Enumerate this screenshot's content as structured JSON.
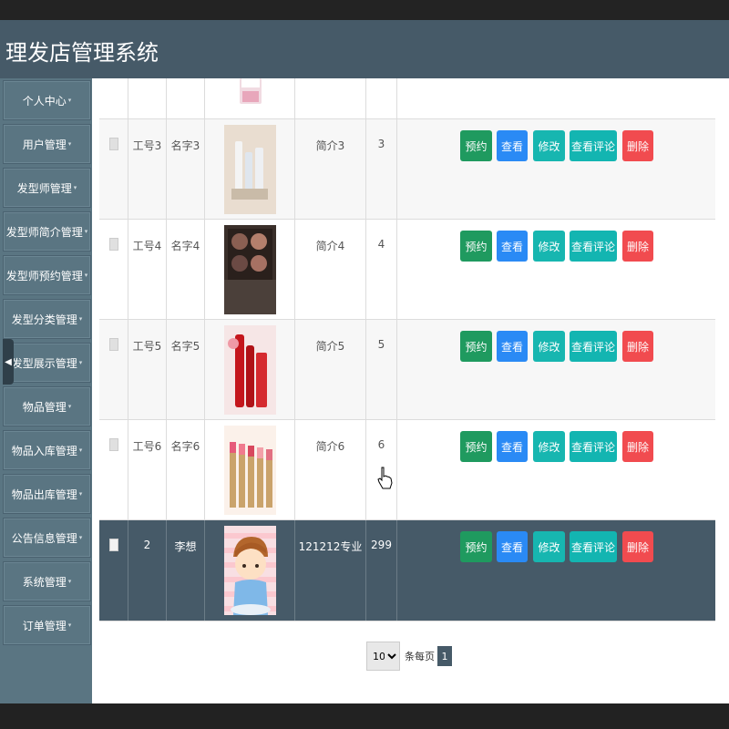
{
  "app": {
    "title": "理发店管理系统"
  },
  "sidebar": {
    "items": [
      {
        "label": "个人中心"
      },
      {
        "label": "用户管理"
      },
      {
        "label": "发型师管理"
      },
      {
        "label": "发型师简介管理"
      },
      {
        "label": "发型师预约管理"
      },
      {
        "label": "发型分类管理"
      },
      {
        "label": "发型展示管理"
      },
      {
        "label": "物品管理"
      },
      {
        "label": "物品入库管理"
      },
      {
        "label": "物品出库管理"
      },
      {
        "label": "公告信息管理"
      },
      {
        "label": "系统管理"
      },
      {
        "label": "订单管理"
      }
    ]
  },
  "table": {
    "rows": [
      {
        "gonghao": "工号3",
        "mingzi": "名字3",
        "jianjie": "简介3",
        "num": "3",
        "image": "skincare-bottles"
      },
      {
        "gonghao": "工号4",
        "mingzi": "名字4",
        "jianjie": "简介4",
        "num": "4",
        "image": "eyeshadow-palette"
      },
      {
        "gonghao": "工号5",
        "mingzi": "名字5",
        "jianjie": "简介5",
        "num": "5",
        "image": "red-bottles"
      },
      {
        "gonghao": "工号6",
        "mingzi": "名字6",
        "jianjie": "简介6",
        "num": "6",
        "image": "lipsticks"
      },
      {
        "gonghao": "2",
        "mingzi": "李想",
        "jianjie": "121212专业",
        "num": "299",
        "image": "cartoon-boy",
        "selected": true
      }
    ],
    "actions": {
      "reserve": "预约",
      "view": "查看",
      "edit": "修改",
      "comments": "查看评论",
      "delete": "删除"
    }
  },
  "pagination": {
    "page_size": "10",
    "per_page_label": "条每页",
    "current_page": "1"
  },
  "colors": {
    "header": "#465a68",
    "sidebar": "#5a7582",
    "reserve": "#1f9a5f",
    "view": "#2a8af5",
    "edit": "#17b6b0",
    "delete": "#f14b4f"
  }
}
